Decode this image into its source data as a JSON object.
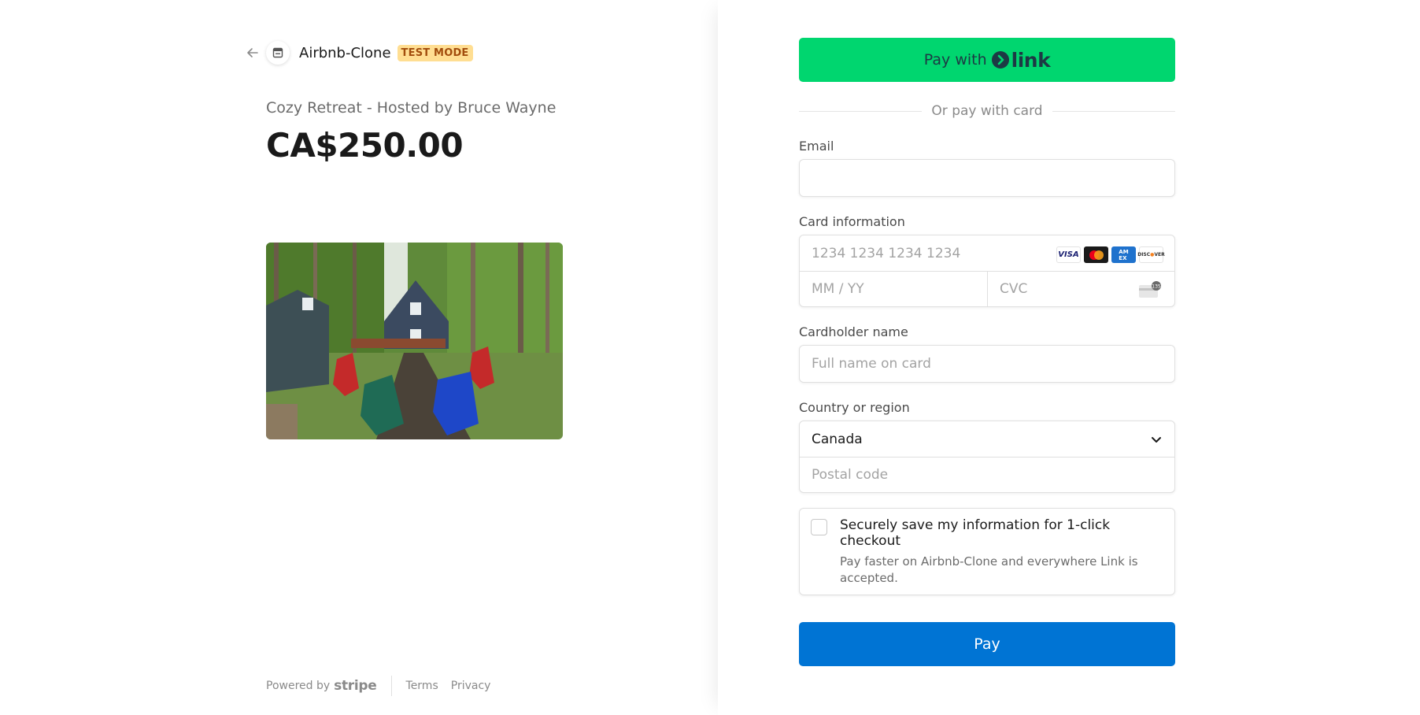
{
  "merchant": {
    "name": "Airbnb-Clone",
    "badge": "TEST MODE"
  },
  "product": {
    "name": "Cozy Retreat - Hosted by Bruce Wayne",
    "price": "CA$250.00"
  },
  "footer": {
    "powered_by": "Powered by",
    "stripe": "stripe",
    "terms": "Terms",
    "privacy": "Privacy"
  },
  "form": {
    "link_pay_with": "Pay with",
    "link_word": "link",
    "or_divider": "Or pay with card",
    "email_label": "Email",
    "email_value": "",
    "card_label": "Card information",
    "card_number_placeholder": "1234 1234 1234 1234",
    "expiry_placeholder": "MM / YY",
    "cvc_placeholder": "CVC",
    "card_brands": [
      "VISA",
      "Mastercard",
      "American Express",
      "Discover"
    ],
    "cardholder_label": "Cardholder name",
    "cardholder_placeholder": "Full name on card",
    "country_label": "Country or region",
    "country_value": "Canada",
    "postal_placeholder": "Postal code",
    "save_title": "Securely save my information for 1-click checkout",
    "save_subtitle": "Pay faster on Airbnb-Clone and everywhere Link is accepted.",
    "pay_button": "Pay"
  },
  "colors": {
    "link_green": "#00d66f",
    "pay_blue": "#0074d4",
    "badge_bg": "#ffde92",
    "badge_text": "#a24d0d"
  }
}
